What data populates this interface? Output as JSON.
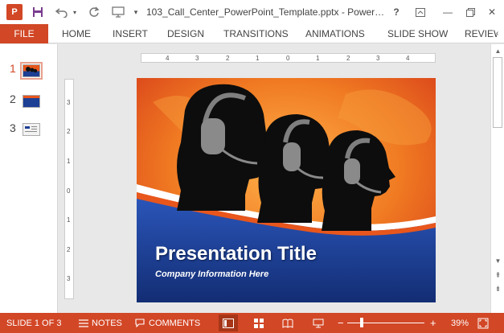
{
  "app": {
    "logo_letter": "P",
    "document_title": "103_Call_Center_PowerPoint_Template.pptx - Power…",
    "window_controls": {
      "help": "?",
      "minimize": "—",
      "close": "✕"
    }
  },
  "ribbon": {
    "file_label": "FILE",
    "tabs": [
      "HOME",
      "INSERT",
      "DESIGN",
      "TRANSITIONS",
      "ANIMATIONS",
      "SLIDE SHOW",
      "REVIEW"
    ]
  },
  "thumbnails": [
    {
      "number": "1",
      "active": true
    },
    {
      "number": "2",
      "active": false
    },
    {
      "number": "3",
      "active": false
    }
  ],
  "ruler": {
    "horizontal": [
      "4",
      "3",
      "2",
      "1",
      "0",
      "1",
      "2",
      "3",
      "4"
    ],
    "vertical": [
      "3",
      "2",
      "1",
      "0",
      "1",
      "2",
      "3"
    ]
  },
  "slide": {
    "title": "Presentation Title",
    "subtitle": "Company Information Here",
    "colors": {
      "orange": "#e8561c",
      "blue": "#1d3f94",
      "silhouette": "#0d0d0d",
      "headset": "#8a8a8a"
    }
  },
  "status": {
    "slide_counter": "SLIDE 1 OF 3",
    "notes_label": "NOTES",
    "comments_label": "COMMENTS",
    "zoom_minus": "−",
    "zoom_plus": "+",
    "zoom_level": "39%",
    "accent": "#d24726"
  }
}
